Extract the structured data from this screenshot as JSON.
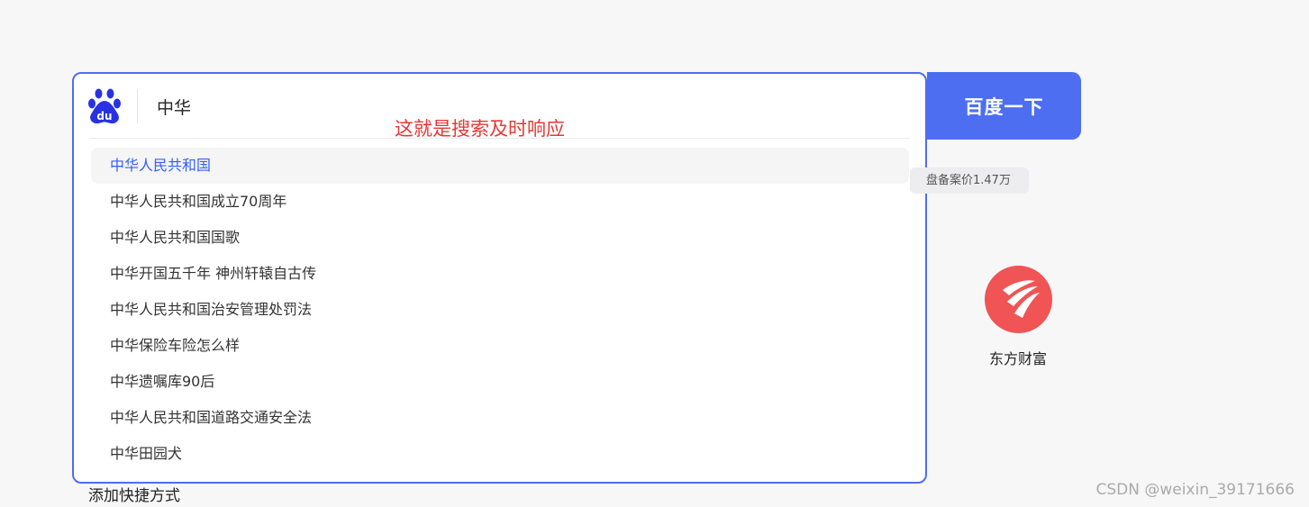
{
  "search": {
    "query": "中华",
    "button_label": "百度一下",
    "suggestions": [
      "中华人民共和国",
      "中华人民共和国成立70周年",
      "中华人民共和国国歌",
      "中华开国五千年 神州轩辕自古传",
      "中华人民共和国治安管理处罚法",
      "中华保险车险怎么样",
      "中华遗嘱库90后",
      "中华人民共和国道路交通安全法",
      "中华田园犬"
    ]
  },
  "annotation_text": "这就是搜索及时响应",
  "hot_tag": {
    "text": "盘备案价1.47万"
  },
  "shortcut": {
    "label": "东方财富",
    "icon": "dongfang-caifu-icon",
    "color": "#f05454"
  },
  "add_shortcut_label": "添加快捷方式",
  "watermark": "CSDN @weixin_39171666",
  "colors": {
    "accent": "#4e6ef2",
    "annotation": "#e53935",
    "active_suggestion": "#315efb"
  },
  "logo_icon": "baidu-paw-icon"
}
